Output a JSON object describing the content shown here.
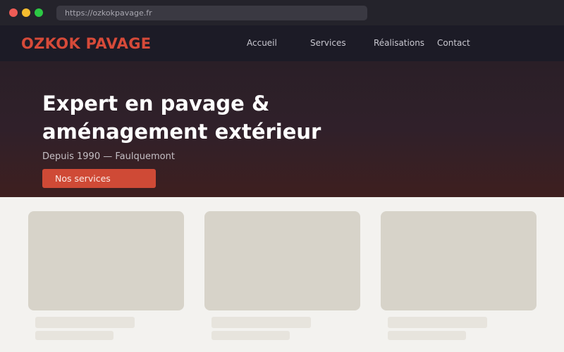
{
  "browser": {
    "url": "https://ozkokpavage.fr"
  },
  "nav": {
    "logo": "OZKOK PAVAGE",
    "links": [
      "Accueil",
      "Services",
      "Réalisations",
      "Contact"
    ]
  },
  "hero": {
    "title_line1": "Expert en pavage &",
    "title_line2": "aménagement extérieur",
    "subtitle": "Depuis 1990 — Faulquemont",
    "cta": "Nos services"
  },
  "colors": {
    "brand": "#d64a39",
    "cta": "#cf4a36",
    "nav_bg": "#1c1b26",
    "page_bg": "#f3f2ef",
    "placeholder": "#d7d3c9"
  }
}
